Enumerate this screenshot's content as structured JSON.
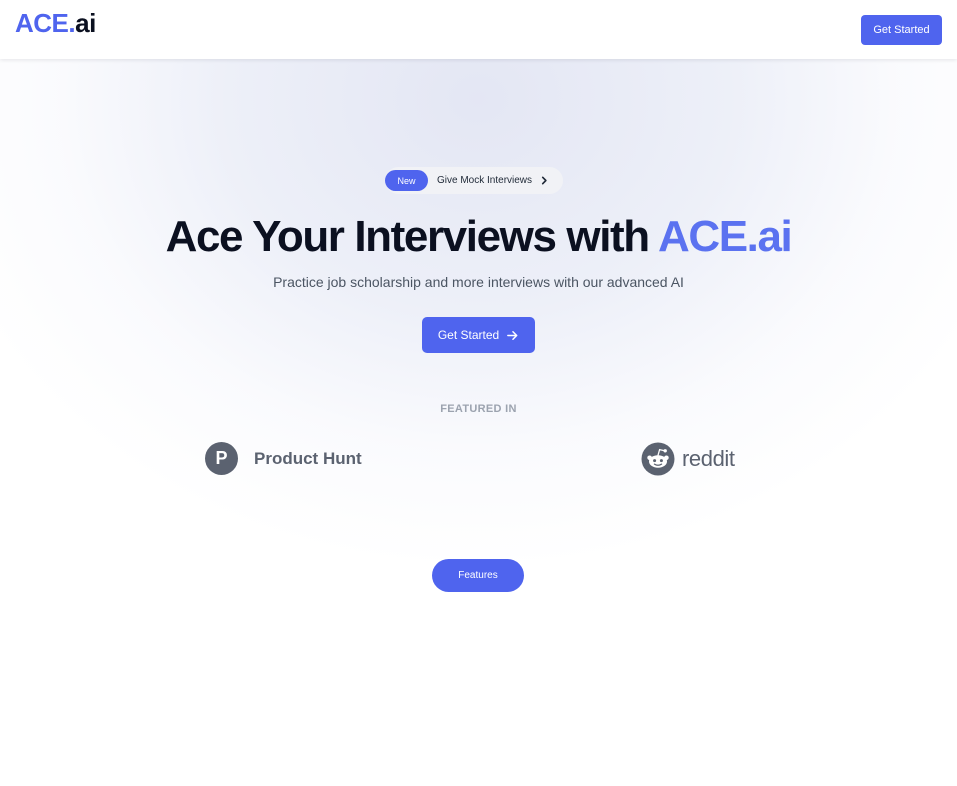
{
  "header": {
    "brand_main": "ACE",
    "brand_dot": ".",
    "brand_suffix": "ai",
    "cta_label": "Get Started"
  },
  "announcement": {
    "badge": "New",
    "text": "Give Mock Interviews",
    "icon": "chevron-right-icon"
  },
  "hero": {
    "title_prefix": "Ace Your Interviews with ",
    "title_accent": "ACE.ai",
    "subtitle": "Practice job scholarship and more interviews with our advanced AI",
    "cta_label": "Get Started",
    "cta_icon": "arrow-right-icon"
  },
  "featured": {
    "label": "FEATURED IN",
    "logos": [
      {
        "letter": "P",
        "name": "Product Hunt",
        "icon": "product-hunt-icon"
      },
      {
        "name": "reddit",
        "icon": "reddit-icon"
      }
    ]
  },
  "sections": {
    "features_label": "Features"
  },
  "colors": {
    "accent": "#4f64ee",
    "headline_accent": "#5b72f0",
    "text_dark": "#0b1020",
    "logo_gray": "#5b6270",
    "muted": "#9ca3af"
  }
}
